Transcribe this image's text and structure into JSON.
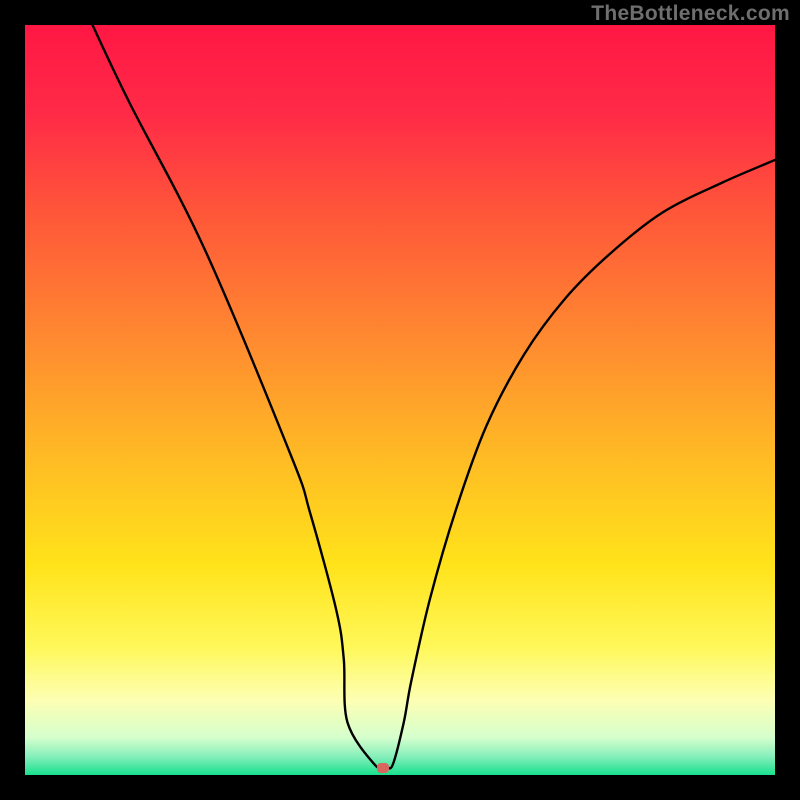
{
  "watermark": "TheBottleneck.com",
  "chart_data": {
    "type": "line",
    "title": "",
    "xlabel": "",
    "ylabel": "",
    "xlim": [
      0,
      100
    ],
    "ylim": [
      0,
      100
    ],
    "grid": false,
    "legend": false,
    "series": [
      {
        "name": "bottleneck-curve",
        "x": [
          9.0,
          14.0,
          24.0,
          35.5,
          38.0,
          41.5,
          42.5,
          43.0,
          46.7,
          48.0,
          49.0,
          50.5,
          51.5,
          54.0,
          57.5,
          61.5,
          66.5,
          72.0,
          78.0,
          85.0,
          93.0,
          100.0
        ],
        "y": [
          100.0,
          89.5,
          70.0,
          42.5,
          35.0,
          22.0,
          15.5,
          7.0,
          1.3,
          1.3,
          1.3,
          7.0,
          12.5,
          23.5,
          35.5,
          46.5,
          56.0,
          63.5,
          69.5,
          75.0,
          79.0,
          82.0
        ]
      }
    ],
    "annotations": [
      {
        "name": "optimum-marker",
        "x": 47.7,
        "y": 1.0
      }
    ],
    "background_gradient": {
      "direction": "vertical",
      "stops": [
        {
          "offset": 0.0,
          "color": "#ff1744"
        },
        {
          "offset": 0.12,
          "color": "#ff2b47"
        },
        {
          "offset": 0.25,
          "color": "#ff5639"
        },
        {
          "offset": 0.42,
          "color": "#ff8a30"
        },
        {
          "offset": 0.58,
          "color": "#ffbc24"
        },
        {
          "offset": 0.72,
          "color": "#ffe31a"
        },
        {
          "offset": 0.83,
          "color": "#fff85a"
        },
        {
          "offset": 0.9,
          "color": "#fdffb3"
        },
        {
          "offset": 0.95,
          "color": "#d5ffcd"
        },
        {
          "offset": 0.975,
          "color": "#87efbb"
        },
        {
          "offset": 1.0,
          "color": "#18e08e"
        }
      ]
    }
  }
}
